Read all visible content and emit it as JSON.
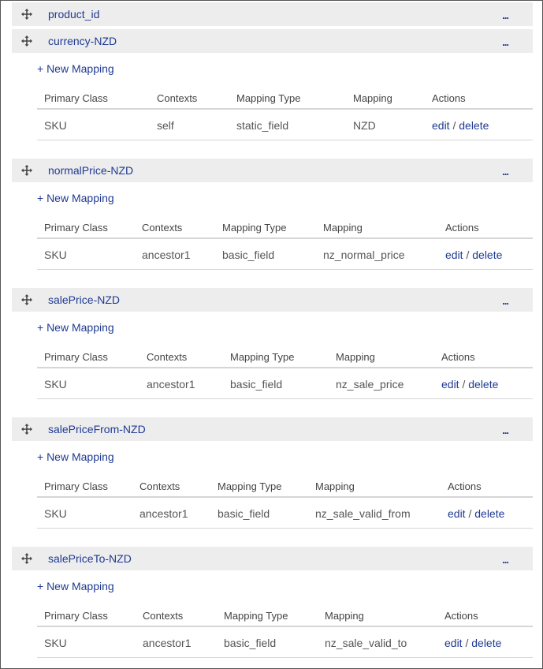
{
  "header": {
    "title": "product_id",
    "more_label": "...",
    "drag_icon": "move-icon"
  },
  "sections": [
    {
      "title": "currency-NZD",
      "more_label": "...",
      "new_mapping_label": "+ New Mapping",
      "columns": [
        "Primary Class",
        "Contexts",
        "Mapping Type",
        "Mapping",
        "Actions"
      ],
      "rows": [
        {
          "primary_class": "SKU",
          "contexts": "self",
          "mapping_type": "static_field",
          "mapping": "NZD",
          "edit_label": "edit",
          "separator": "/",
          "delete_label": "delete"
        }
      ]
    },
    {
      "title": "normalPrice-NZD",
      "more_label": "...",
      "new_mapping_label": "+ New Mapping",
      "columns": [
        "Primary Class",
        "Contexts",
        "Mapping Type",
        "Mapping",
        "Actions"
      ],
      "rows": [
        {
          "primary_class": "SKU",
          "contexts": "ancestor1",
          "mapping_type": "basic_field",
          "mapping": "nz_normal_price",
          "edit_label": "edit",
          "separator": "/",
          "delete_label": "delete"
        }
      ]
    },
    {
      "title": "salePrice-NZD",
      "more_label": "...",
      "new_mapping_label": "+ New Mapping",
      "columns": [
        "Primary Class",
        "Contexts",
        "Mapping Type",
        "Mapping",
        "Actions"
      ],
      "rows": [
        {
          "primary_class": "SKU",
          "contexts": "ancestor1",
          "mapping_type": "basic_field",
          "mapping": "nz_sale_price",
          "edit_label": "edit",
          "separator": "/",
          "delete_label": "delete"
        }
      ]
    },
    {
      "title": "salePriceFrom-NZD",
      "more_label": "...",
      "new_mapping_label": "+ New Mapping",
      "columns": [
        "Primary Class",
        "Contexts",
        "Mapping Type",
        "Mapping",
        "Actions"
      ],
      "rows": [
        {
          "primary_class": "SKU",
          "contexts": "ancestor1",
          "mapping_type": "basic_field",
          "mapping": "nz_sale_valid_from",
          "edit_label": "edit",
          "separator": "/",
          "delete_label": "delete"
        }
      ]
    },
    {
      "title": "salePriceTo-NZD",
      "more_label": "...",
      "new_mapping_label": "+ New Mapping",
      "columns": [
        "Primary Class",
        "Contexts",
        "Mapping Type",
        "Mapping",
        "Actions"
      ],
      "rows": [
        {
          "primary_class": "SKU",
          "contexts": "ancestor1",
          "mapping_type": "basic_field",
          "mapping": "nz_sale_valid_to",
          "edit_label": "edit",
          "separator": "/",
          "delete_label": "delete"
        }
      ]
    }
  ],
  "colors": {
    "link": "#1f3a93",
    "header_bg": "#ededed",
    "text": "#555555"
  }
}
